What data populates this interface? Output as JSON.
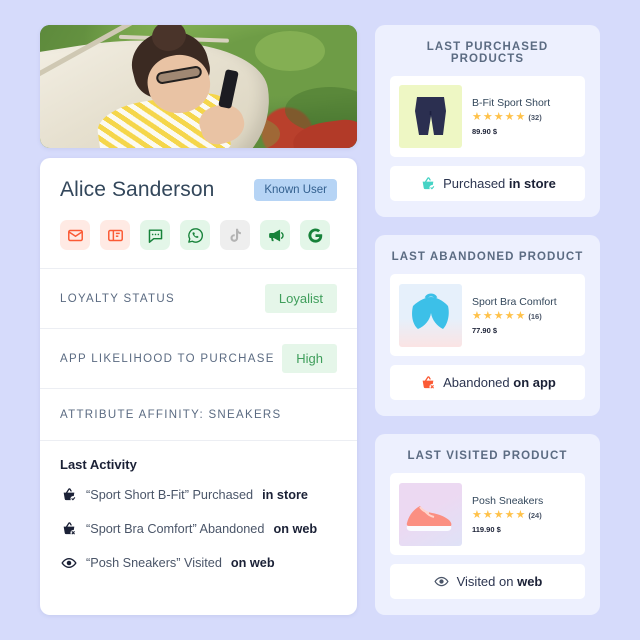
{
  "profile": {
    "name": "Alice Sanderson",
    "badge": "Known User",
    "channels": [
      {
        "name": "email-icon",
        "tone": "red"
      },
      {
        "name": "newsletter-icon",
        "tone": "red"
      },
      {
        "name": "sms-icon",
        "tone": "green"
      },
      {
        "name": "whatsapp-icon",
        "tone": "green"
      },
      {
        "name": "tiktok-icon",
        "tone": "grey"
      },
      {
        "name": "push-notification-icon",
        "tone": "green"
      },
      {
        "name": "google-icon",
        "tone": "green"
      }
    ],
    "attributes": [
      {
        "label": "Loyalty Status",
        "value": "Loyalist"
      },
      {
        "label": "App Likelihood to Purchase",
        "value": "High"
      },
      {
        "label": "Attribute Affinity: Sneakers",
        "value": ""
      }
    ],
    "activity_title": "Last Activity",
    "activity": [
      {
        "icon": "basket-check-icon",
        "text": "“Sport Short B-Fit” Purchased ",
        "strong": "in store"
      },
      {
        "icon": "basket-x-icon",
        "text": "“Sport Bra Comfort” Abandoned ",
        "strong": "on web"
      },
      {
        "icon": "eye-icon",
        "text": "“Posh Sneakers” Visited ",
        "strong": "on web"
      }
    ]
  },
  "panels": [
    {
      "title": "Last Purchased Products",
      "product": {
        "name": "B-Fit Sport Short",
        "stars": 5,
        "reviews": "(32)",
        "price": "89.90 $",
        "image": "sport-shorts"
      },
      "status": {
        "icon": "basket-check-icon",
        "text": "Purchased ",
        "strong": "in store"
      }
    },
    {
      "title": "Last Abandoned Product",
      "product": {
        "name": "Sport Bra Comfort",
        "stars": 5,
        "reviews": "(16)",
        "price": "77.90 $",
        "image": "sport-bra"
      },
      "status": {
        "icon": "basket-x-icon",
        "text": "Abandoned ",
        "strong": "on app"
      }
    },
    {
      "title": "Last Visited Product",
      "product": {
        "name": "Posh Sneakers",
        "stars": 5,
        "reviews": "(24)",
        "price": "119.90 $",
        "image": "sneakers"
      },
      "status": {
        "icon": "eye-icon",
        "text": "Visited on ",
        "strong": "web"
      }
    }
  ],
  "colors": {
    "page_bg": "#d6dbfb",
    "panel_bg": "#edf0fe",
    "badge_blue_bg": "#b6d4f5",
    "badge_blue_text": "#33608f",
    "pill_green_bg": "#e5f6e9",
    "pill_green_text": "#3f9e5b",
    "star": "#ffc24a",
    "accent_teal": "#46d3c5",
    "accent_orange": "#fb5a35"
  }
}
